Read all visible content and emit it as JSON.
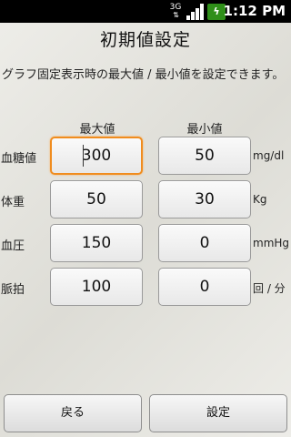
{
  "status_bar": {
    "network_label": "3G",
    "time": "1:12 PM"
  },
  "screen": {
    "title": "初期値設定",
    "description": "グラフ固定表示時の最大値 / 最小値を設定できます。"
  },
  "columns": {
    "max_label": "最大値",
    "min_label": "最小値"
  },
  "rows": [
    {
      "label": "血糖値",
      "max": "300",
      "min": "50",
      "unit": "mg/dl"
    },
    {
      "label": "体重",
      "max": "50",
      "min": "30",
      "unit": "Kg"
    },
    {
      "label": "血圧",
      "max": "150",
      "min": "0",
      "unit": "mmHg"
    },
    {
      "label": "脈拍",
      "max": "100",
      "min": "0",
      "unit": "回 / 分"
    }
  ],
  "buttons": {
    "back": "戻る",
    "set": "設定"
  },
  "colors": {
    "focus_border": "#f08c1e",
    "battery": "#2f8f19"
  }
}
